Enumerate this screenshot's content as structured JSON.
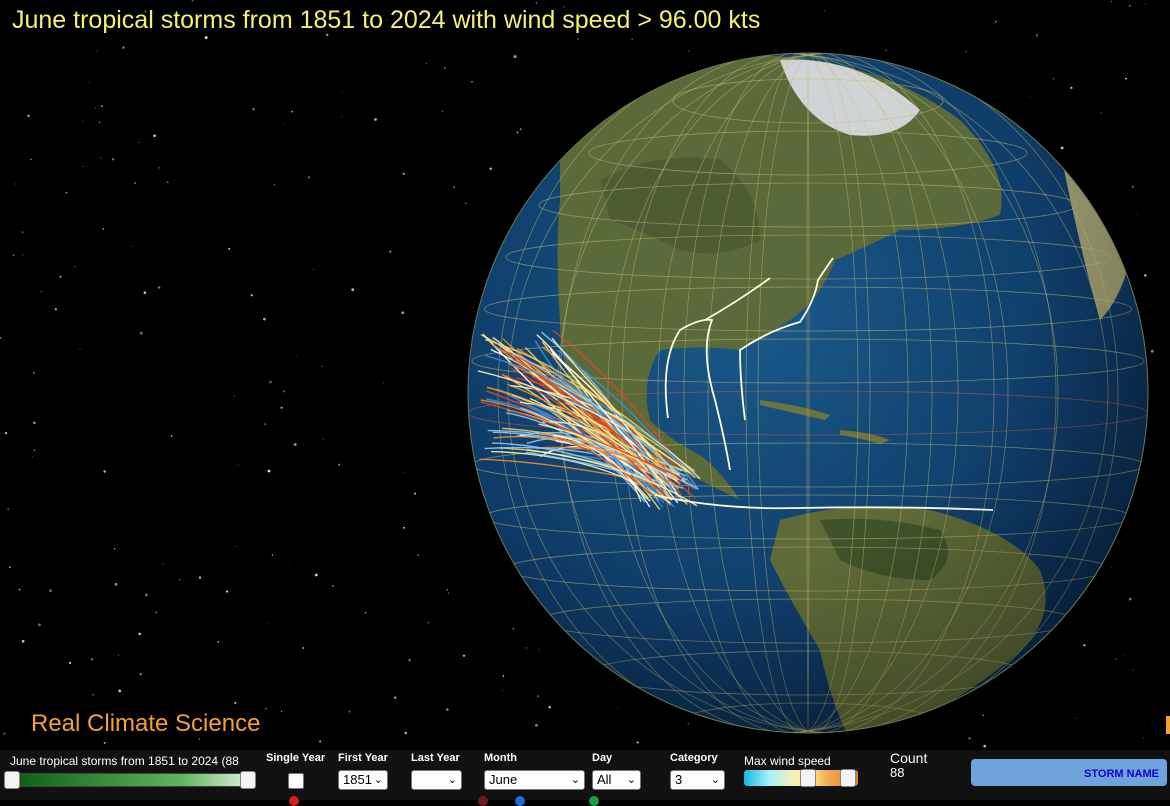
{
  "title": "June tropical storms from 1851 to 2024 with wind speed > 96.00 kts",
  "brand": "Real Climate Science",
  "controls": {
    "description": "June tropical storms from 1851 to 2024 (88",
    "single_year_label": "Single Year",
    "first_year_label": "First Year",
    "first_year_value": "1851",
    "last_year_label": "Last Year",
    "last_year_value": "",
    "month_label": "Month",
    "month_value": "June",
    "day_label": "Day",
    "day_value": "All",
    "category_label": "Category",
    "category_value": "3",
    "wind_label": "Max wind speed",
    "count_label": "Count",
    "count_value": "88",
    "storm_name_button": "STORM NAME"
  },
  "colors": {
    "title": "#f4f070",
    "brand": "#f5a030",
    "ocean": "#0e3a66",
    "storm_track_colors": [
      "#ffffff",
      "#fff3b0",
      "#f5d060",
      "#f08a30",
      "#d84a20",
      "#8ec8f0",
      "#3a8fe0"
    ]
  },
  "icons": {
    "select_chevron": "chevron-down-icon",
    "color_dots": [
      "red-dot-icon",
      "dark-red-dot-icon",
      "blue-dot-icon",
      "green-dot-icon"
    ]
  }
}
